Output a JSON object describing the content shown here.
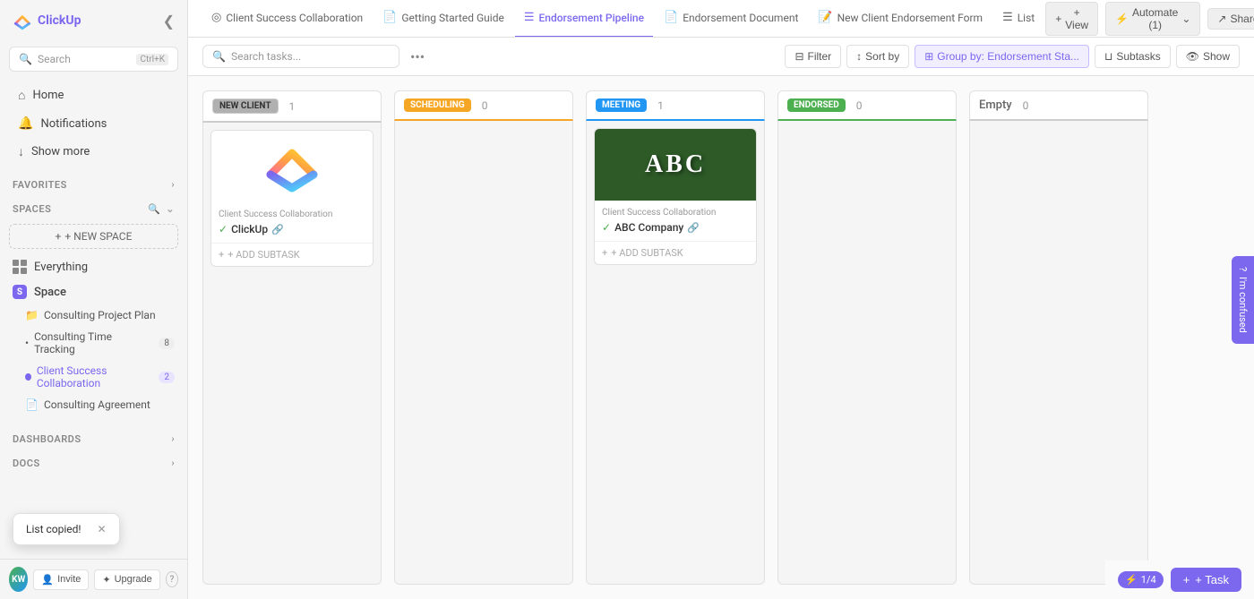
{
  "app": {
    "logo_text": "ClickUp",
    "collapse_icon": "❮"
  },
  "sidebar": {
    "search_placeholder": "Search",
    "search_shortcut": "Ctrl+K",
    "nav_items": [
      {
        "label": "Home",
        "icon": "⌂"
      },
      {
        "label": "Notifications",
        "icon": "🔔"
      },
      {
        "label": "Show more",
        "icon": "↓"
      }
    ],
    "favorites_label": "FAVORITES",
    "spaces_label": "SPACES",
    "new_space_label": "+ NEW SPACE",
    "everything_label": "Everything",
    "space_label": "Space",
    "space_badge": "S",
    "sub_items": [
      {
        "label": "Consulting Project Plan",
        "type": "folder",
        "badge": ""
      },
      {
        "label": "Consulting Time Tracking",
        "type": "list",
        "badge": "8"
      },
      {
        "label": "Client Success Collaboration",
        "type": "list",
        "badge": "2",
        "active": true
      },
      {
        "label": "Consulting Agreement",
        "type": "doc",
        "badge": ""
      }
    ],
    "dashboards_label": "DASHBOARDS",
    "docs_label": "DOCS",
    "invite_label": "Invite",
    "upgrade_label": "Upgrade"
  },
  "tabs": [
    {
      "label": "Client Success Collaboration",
      "icon": "◎",
      "active": false
    },
    {
      "label": "Getting Started Guide",
      "icon": "📄",
      "active": false
    },
    {
      "label": "Endorsement Pipeline",
      "icon": "☰",
      "active": true
    },
    {
      "label": "Endorsement Document",
      "icon": "📄",
      "active": false
    },
    {
      "label": "New Client Endorsement Form",
      "icon": "📝",
      "active": false
    },
    {
      "label": "List",
      "icon": "☰",
      "active": false
    }
  ],
  "tab_actions": {
    "view_label": "+ View",
    "automate_label": "Automate (1)",
    "share_label": "Share"
  },
  "toolbar": {
    "search_placeholder": "Search tasks...",
    "filter_label": "Filter",
    "sort_label": "Sort by",
    "group_label": "Group by: Endorsement Sta...",
    "subtasks_label": "Subtasks",
    "show_label": "Show"
  },
  "columns": [
    {
      "id": "new-client",
      "badge_label": "NEW CLIENT",
      "badge_style": "new-client",
      "count": "1"
    },
    {
      "id": "scheduling",
      "badge_label": "SCHEDULING",
      "badge_style": "scheduling",
      "count": "0"
    },
    {
      "id": "meeting",
      "badge_label": "MEETING",
      "badge_style": "meeting",
      "count": "1"
    },
    {
      "id": "endorsed",
      "badge_label": "ENDORSED",
      "badge_style": "endorsed",
      "count": "0"
    },
    {
      "id": "empty",
      "badge_label": "Empty",
      "badge_style": "empty",
      "count": "0"
    }
  ],
  "cards": {
    "new_client_card": {
      "project": "Client Success Collaboration",
      "title": "ClickUp",
      "has_link": true,
      "add_subtask": "+ ADD SUBTASK"
    },
    "meeting_card": {
      "project": "Client Success Collaboration",
      "title": "ABC Company",
      "has_link": true,
      "add_subtask": "+ ADD SUBTASK"
    }
  },
  "toast": {
    "message": "List copied!",
    "close_icon": "✕"
  },
  "bottom": {
    "bolt_label": "1/4",
    "task_label": "+ Task",
    "help_icon": "?",
    "confused_label": "I'm confused"
  }
}
